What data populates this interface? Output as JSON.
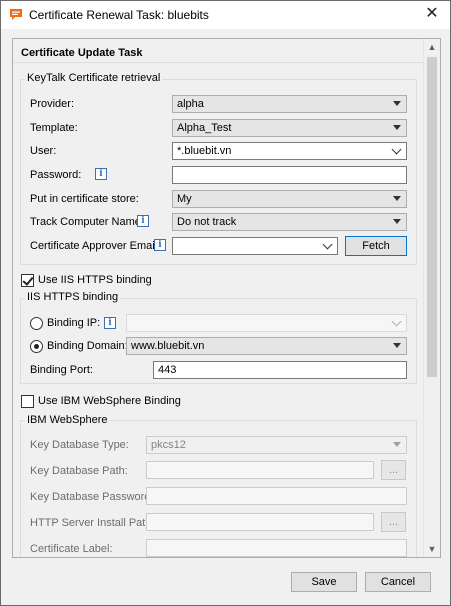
{
  "window": {
    "title": "Certificate Renewal Task: bluebits",
    "close_label": "✕"
  },
  "task": {
    "title": "Certificate Update Task"
  },
  "keytalk": {
    "group_title": "KeyTalk Certificate retrieval",
    "provider_label": "Provider:",
    "provider_value": "alpha",
    "template_label": "Template:",
    "template_value": "Alpha_Test",
    "user_label": "User:",
    "user_value": "*.bluebit.vn",
    "password_label": "Password:",
    "password_value": "",
    "store_label": "Put in certificate store:",
    "store_value": "My",
    "track_label": "Track Computer Name:",
    "track_value": "Do not track",
    "approver_label": "Certificate Approver Email:",
    "approver_value": "",
    "fetch_label": "Fetch"
  },
  "iis": {
    "use_label": "Use IIS HTTPS binding",
    "use_checked": true,
    "group_title": "IIS HTTPS binding",
    "binding_ip_label": "Binding IP:",
    "binding_ip_value": "",
    "binding_domain_label": "Binding Domain:",
    "binding_domain_value": "www.bluebit.vn",
    "selected_binding": "domain",
    "port_label": "Binding Port:",
    "port_value": "443"
  },
  "websphere": {
    "use_label": "Use IBM WebSphere Binding",
    "use_checked": false,
    "group_title": "IBM WebSphere",
    "db_type_label": "Key Database Type:",
    "db_type_value": "pkcs12",
    "db_path_label": "Key Database Path:",
    "db_path_value": "",
    "db_password_label": "Key Database Password:",
    "db_password_value": "",
    "http_path_label": "HTTP Server Install Path:",
    "http_path_value": "",
    "cert_label_label": "Certificate Label:",
    "cert_label_value": "",
    "browse_label": "..."
  },
  "footer": {
    "save_label": "Save",
    "cancel_label": "Cancel"
  },
  "colors": {
    "accent": "#0078d7",
    "info_blue": "#3c6fb5",
    "app_icon_orange": "#f26a1b"
  },
  "icons": {
    "app": "chat-bubble-icon",
    "info": "info-icon",
    "close": "close-icon"
  }
}
